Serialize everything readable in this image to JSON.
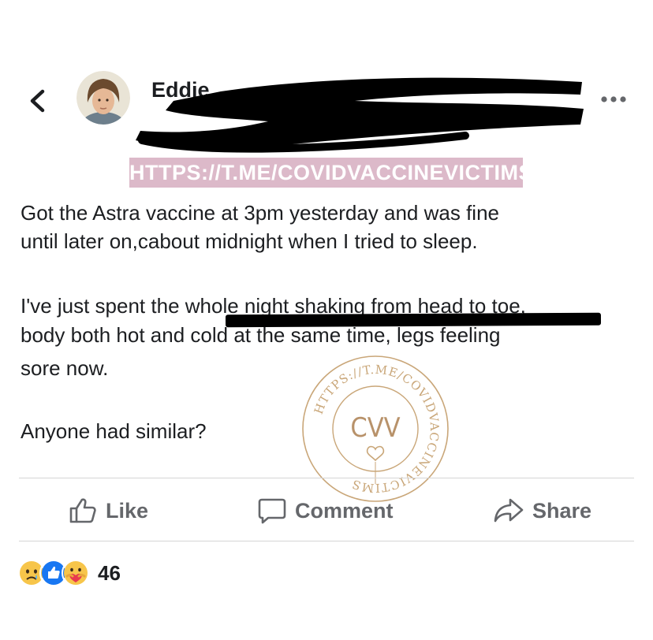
{
  "header": {
    "back_icon": "chevron-left-icon",
    "author_name_visible": "Eddie",
    "more_icon": "ellipsis-icon"
  },
  "watermark": {
    "url": "HTTPS://T.ME/COVIDVACCINEVICTIMS",
    "banner_color": "#dcb9c9",
    "stamp_center": "CVV",
    "stamp_ring": "HTTPS://T.ME/COVIDVACCINEVICTIMS",
    "stamp_color": "#c9a678"
  },
  "post": {
    "line1": "Got the Astra vaccine at 3pm yesterday and was fine",
    "line2": "until later on,cabout midnight when I tried to sleep.",
    "line3": "I've just spent the whole night shaking from head to toe,",
    "line4": "body both hot and cold at the same time, legs feeling",
    "line5": "sore now.",
    "line6": "Anyone had similar?"
  },
  "actions": {
    "like": "Like",
    "comment": "Comment",
    "share": "Share"
  },
  "reactions": {
    "icons": [
      "sad-emoji-icon",
      "like-reaction-icon",
      "care-emoji-icon"
    ],
    "count": "46"
  },
  "colors": {
    "text": "#1c1e21",
    "secondary": "#65676b",
    "like_blue": "#1877f2"
  }
}
